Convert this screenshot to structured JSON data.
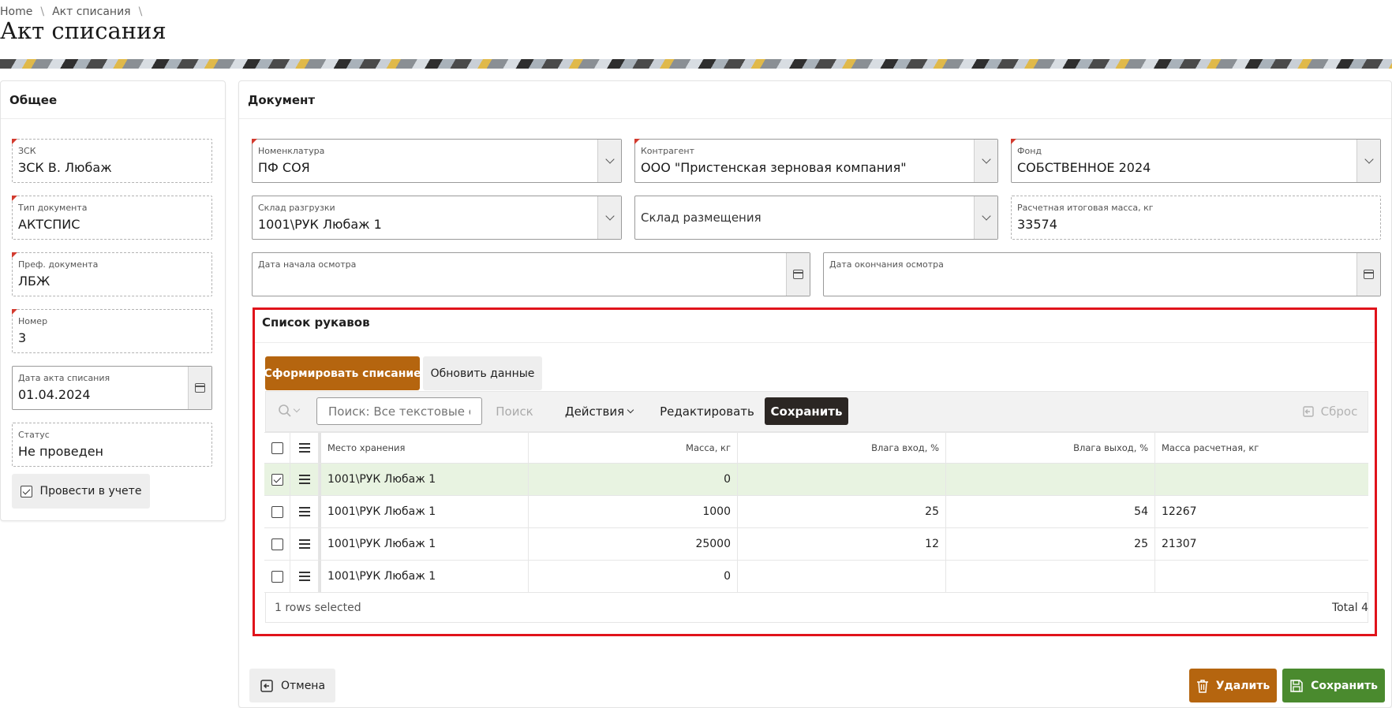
{
  "breadcrumb": {
    "home": "Home",
    "current": "Акт списания",
    "sep": "\\"
  },
  "page_title": "Акт списания",
  "general": {
    "title": "Общее",
    "fields": [
      {
        "label": "ЗСК",
        "value": "ЗСК В. Любаж"
      },
      {
        "label": "Тип документа",
        "value": "АКТСПИС"
      },
      {
        "label": "Преф. документа",
        "value": "ЛБЖ"
      },
      {
        "label": "Номер",
        "value": "3"
      },
      {
        "label": "Дата акта списания",
        "value": "01.04.2024"
      },
      {
        "label": "Статус",
        "value": "Не проведен"
      }
    ],
    "post_checkbox_label": "Провести в учете"
  },
  "document": {
    "title": "Документ",
    "nomenclature": {
      "label": "Номенклатура",
      "value": "ПФ СОЯ"
    },
    "counterparty": {
      "label": "Контрагент",
      "value": "ООО \"Пристенская зерновая компания\""
    },
    "fund": {
      "label": "Фонд",
      "value": "СОБСТВЕННОЕ 2024"
    },
    "unload_warehouse": {
      "label": "Склад разгрузки",
      "value": "1001\\РУК Любаж 1"
    },
    "placement_warehouse": {
      "placeholder": "Склад размещения"
    },
    "total_mass": {
      "label": "Расчетная итоговая масса, кг",
      "value": "33574"
    },
    "inspection_start": {
      "label": "Дата начала осмотра",
      "value": ""
    },
    "inspection_end": {
      "label": "Дата окончания осмотра",
      "value": ""
    }
  },
  "sleeves": {
    "title": "Список рукавов",
    "form_button": "Сформировать списание",
    "refresh_button": "Обновить данные",
    "toolbar": {
      "search_placeholder": "Поиск: Все текстовые ст",
      "search_button": "Поиск",
      "actions": "Действия",
      "edit": "Редактировать",
      "save": "Сохранить",
      "reset": "Сброс"
    },
    "columns": [
      "Место хранения",
      "Масса, кг",
      "Влага вход, %",
      "Влага выход, %",
      "Масса расчетная, кг"
    ],
    "rows": [
      {
        "selected": true,
        "location": "1001\\РУК Любаж 1",
        "mass": "0",
        "moisture_in": "",
        "moisture_out": "",
        "calc_mass": ""
      },
      {
        "selected": false,
        "location": "1001\\РУК Любаж 1",
        "mass": "1000",
        "moisture_in": "25",
        "moisture_out": "54",
        "calc_mass": "12267"
      },
      {
        "selected": false,
        "location": "1001\\РУК Любаж 1",
        "mass": "25000",
        "moisture_in": "12",
        "moisture_out": "25",
        "calc_mass": "21307"
      },
      {
        "selected": false,
        "location": "1001\\РУК Любаж 1",
        "mass": "0",
        "moisture_in": "",
        "moisture_out": "",
        "calc_mass": ""
      }
    ],
    "footer": {
      "selected_text": "1 rows selected",
      "total_text": "Total 4"
    }
  },
  "footer_buttons": {
    "cancel": "Отмена",
    "delete": "Удалить",
    "save": "Сохранить"
  },
  "colors": {
    "brown": "#b5650f",
    "green": "#4a8a2e",
    "dark": "#2b2623",
    "red_border": "#e0131b",
    "selected_row": "#e8f3e1"
  }
}
